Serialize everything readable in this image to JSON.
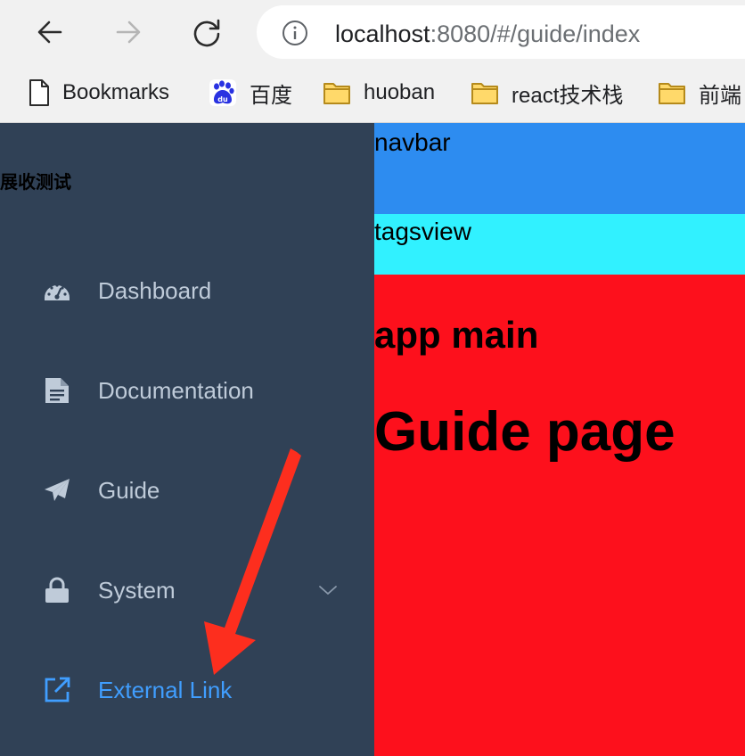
{
  "browser": {
    "url_host": "localhost",
    "url_rest": ":8080/#/guide/index",
    "nav": [
      "back-icon",
      "forward-icon",
      "reload-icon"
    ],
    "bookmarks": [
      {
        "label": "Bookmarks",
        "icon": "document-icon"
      },
      {
        "label": "百度",
        "icon": "baidu-icon"
      },
      {
        "label": "huoban",
        "icon": "folder-icon"
      },
      {
        "label": "react技术栈",
        "icon": "folder-icon"
      },
      {
        "label": "前端",
        "icon": "folder-icon"
      }
    ]
  },
  "sidebar": {
    "title": "展收测试",
    "items": [
      {
        "label": "Dashboard",
        "icon": "dashboard-icon"
      },
      {
        "label": "Documentation",
        "icon": "documentation-icon"
      },
      {
        "label": "Guide",
        "icon": "guide-icon"
      },
      {
        "label": "System",
        "icon": "lock-icon",
        "expandable": true
      },
      {
        "label": "External Link",
        "icon": "external-link-icon",
        "active": true
      }
    ]
  },
  "main": {
    "navbar": "navbar",
    "tagsview": "tagsview",
    "app_main": "app main",
    "page_heading": "Guide page"
  },
  "colors": {
    "sidebar_bg": "#304156",
    "menu_text": "#bfcbd9",
    "menu_active": "#409eff",
    "navbar_bg": "#2d8cf0",
    "tagsview_bg": "#31f1ff",
    "app_main_bg": "#fd101c",
    "annotation_arrow": "#fd2e1e"
  }
}
